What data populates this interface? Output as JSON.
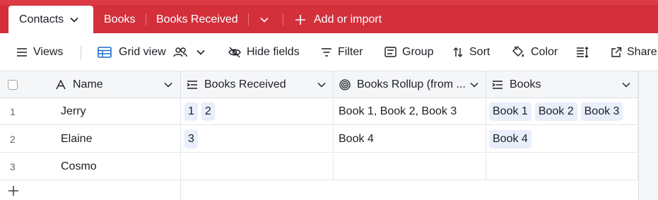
{
  "tabs": {
    "active": "Contacts",
    "others": [
      "Books",
      "Books Received"
    ],
    "add_label": "Add or import"
  },
  "toolbar": {
    "views_label": "Views",
    "grid_view_label": "Grid view",
    "hide_fields_label": "Hide fields",
    "filter_label": "Filter",
    "group_label": "Group",
    "sort_label": "Sort",
    "color_label": "Color",
    "share_label": "Share"
  },
  "columns": [
    {
      "label": "Name",
      "icon": "text-field-icon"
    },
    {
      "label": "Books Received",
      "icon": "linked-record-icon"
    },
    {
      "label": "Books Rollup (from ...",
      "icon": "rollup-icon"
    },
    {
      "label": "Books",
      "icon": "linked-record-icon"
    }
  ],
  "rows": [
    {
      "num": "1",
      "name": "Jerry",
      "received": [
        "1",
        "2"
      ],
      "rollup": "Book 1, Book 2, Book 3",
      "books": [
        "Book 1",
        "Book 2",
        "Book 3"
      ]
    },
    {
      "num": "2",
      "name": "Elaine",
      "received": [
        "3"
      ],
      "rollup": "Book 4",
      "books": [
        "Book 4"
      ]
    },
    {
      "num": "3",
      "name": "Cosmo",
      "received": [],
      "rollup": "",
      "books": []
    }
  ],
  "colors": {
    "brand": "#d3303c",
    "pill_bg": "#e9eefb",
    "header_bg": "#f5f6f8"
  }
}
